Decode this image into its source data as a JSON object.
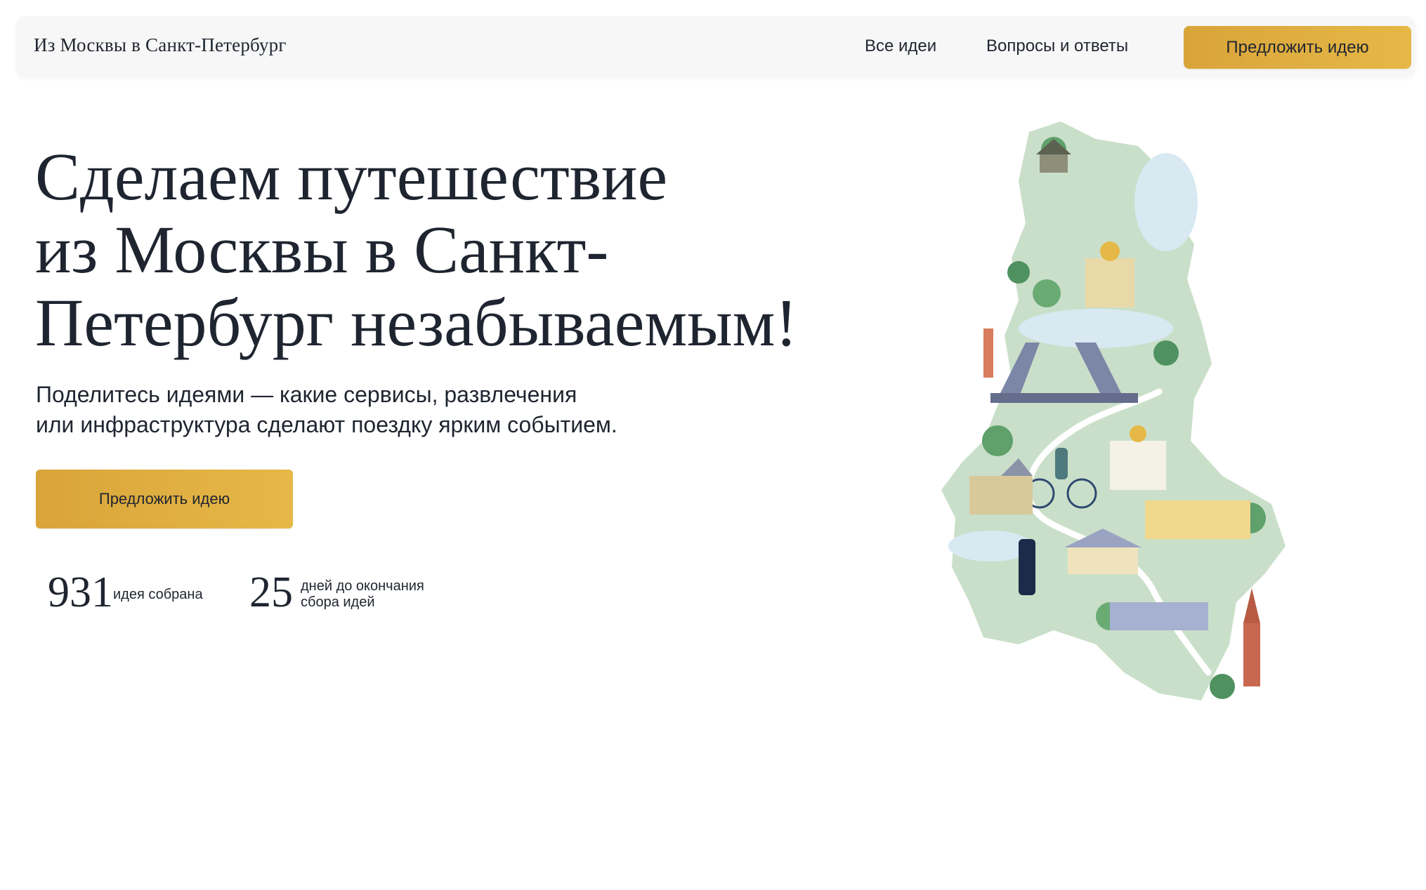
{
  "header": {
    "brand": "Из Москвы в Санкт-Петербург",
    "nav": [
      {
        "label": "Все идеи"
      },
      {
        "label": "Вопросы и ответы"
      }
    ],
    "cta_label": "Предложить идею",
    "cta_color": "#e0ae40"
  },
  "hero": {
    "title_lines": [
      "Сделаем путешествие",
      "из Москвы в Санкт-",
      "Петербург незабываемым!"
    ],
    "subtitle_lines": [
      "Поделитесь идеями — какие сервисы, развлечения",
      "или инфраструктура сделают поездку ярким событием."
    ],
    "cta_label": "Предложить идею"
  },
  "stats": [
    {
      "value": "931",
      "label": "идея собрана"
    },
    {
      "value": "25",
      "label_lines": [
        "дней до окончания",
        "сбора идей"
      ]
    }
  ],
  "illustration": {
    "icon": "route-map-illustration",
    "colors": {
      "land": "#c9dfc9",
      "water": "#d8e9f2",
      "accent": "#e6b847"
    }
  }
}
